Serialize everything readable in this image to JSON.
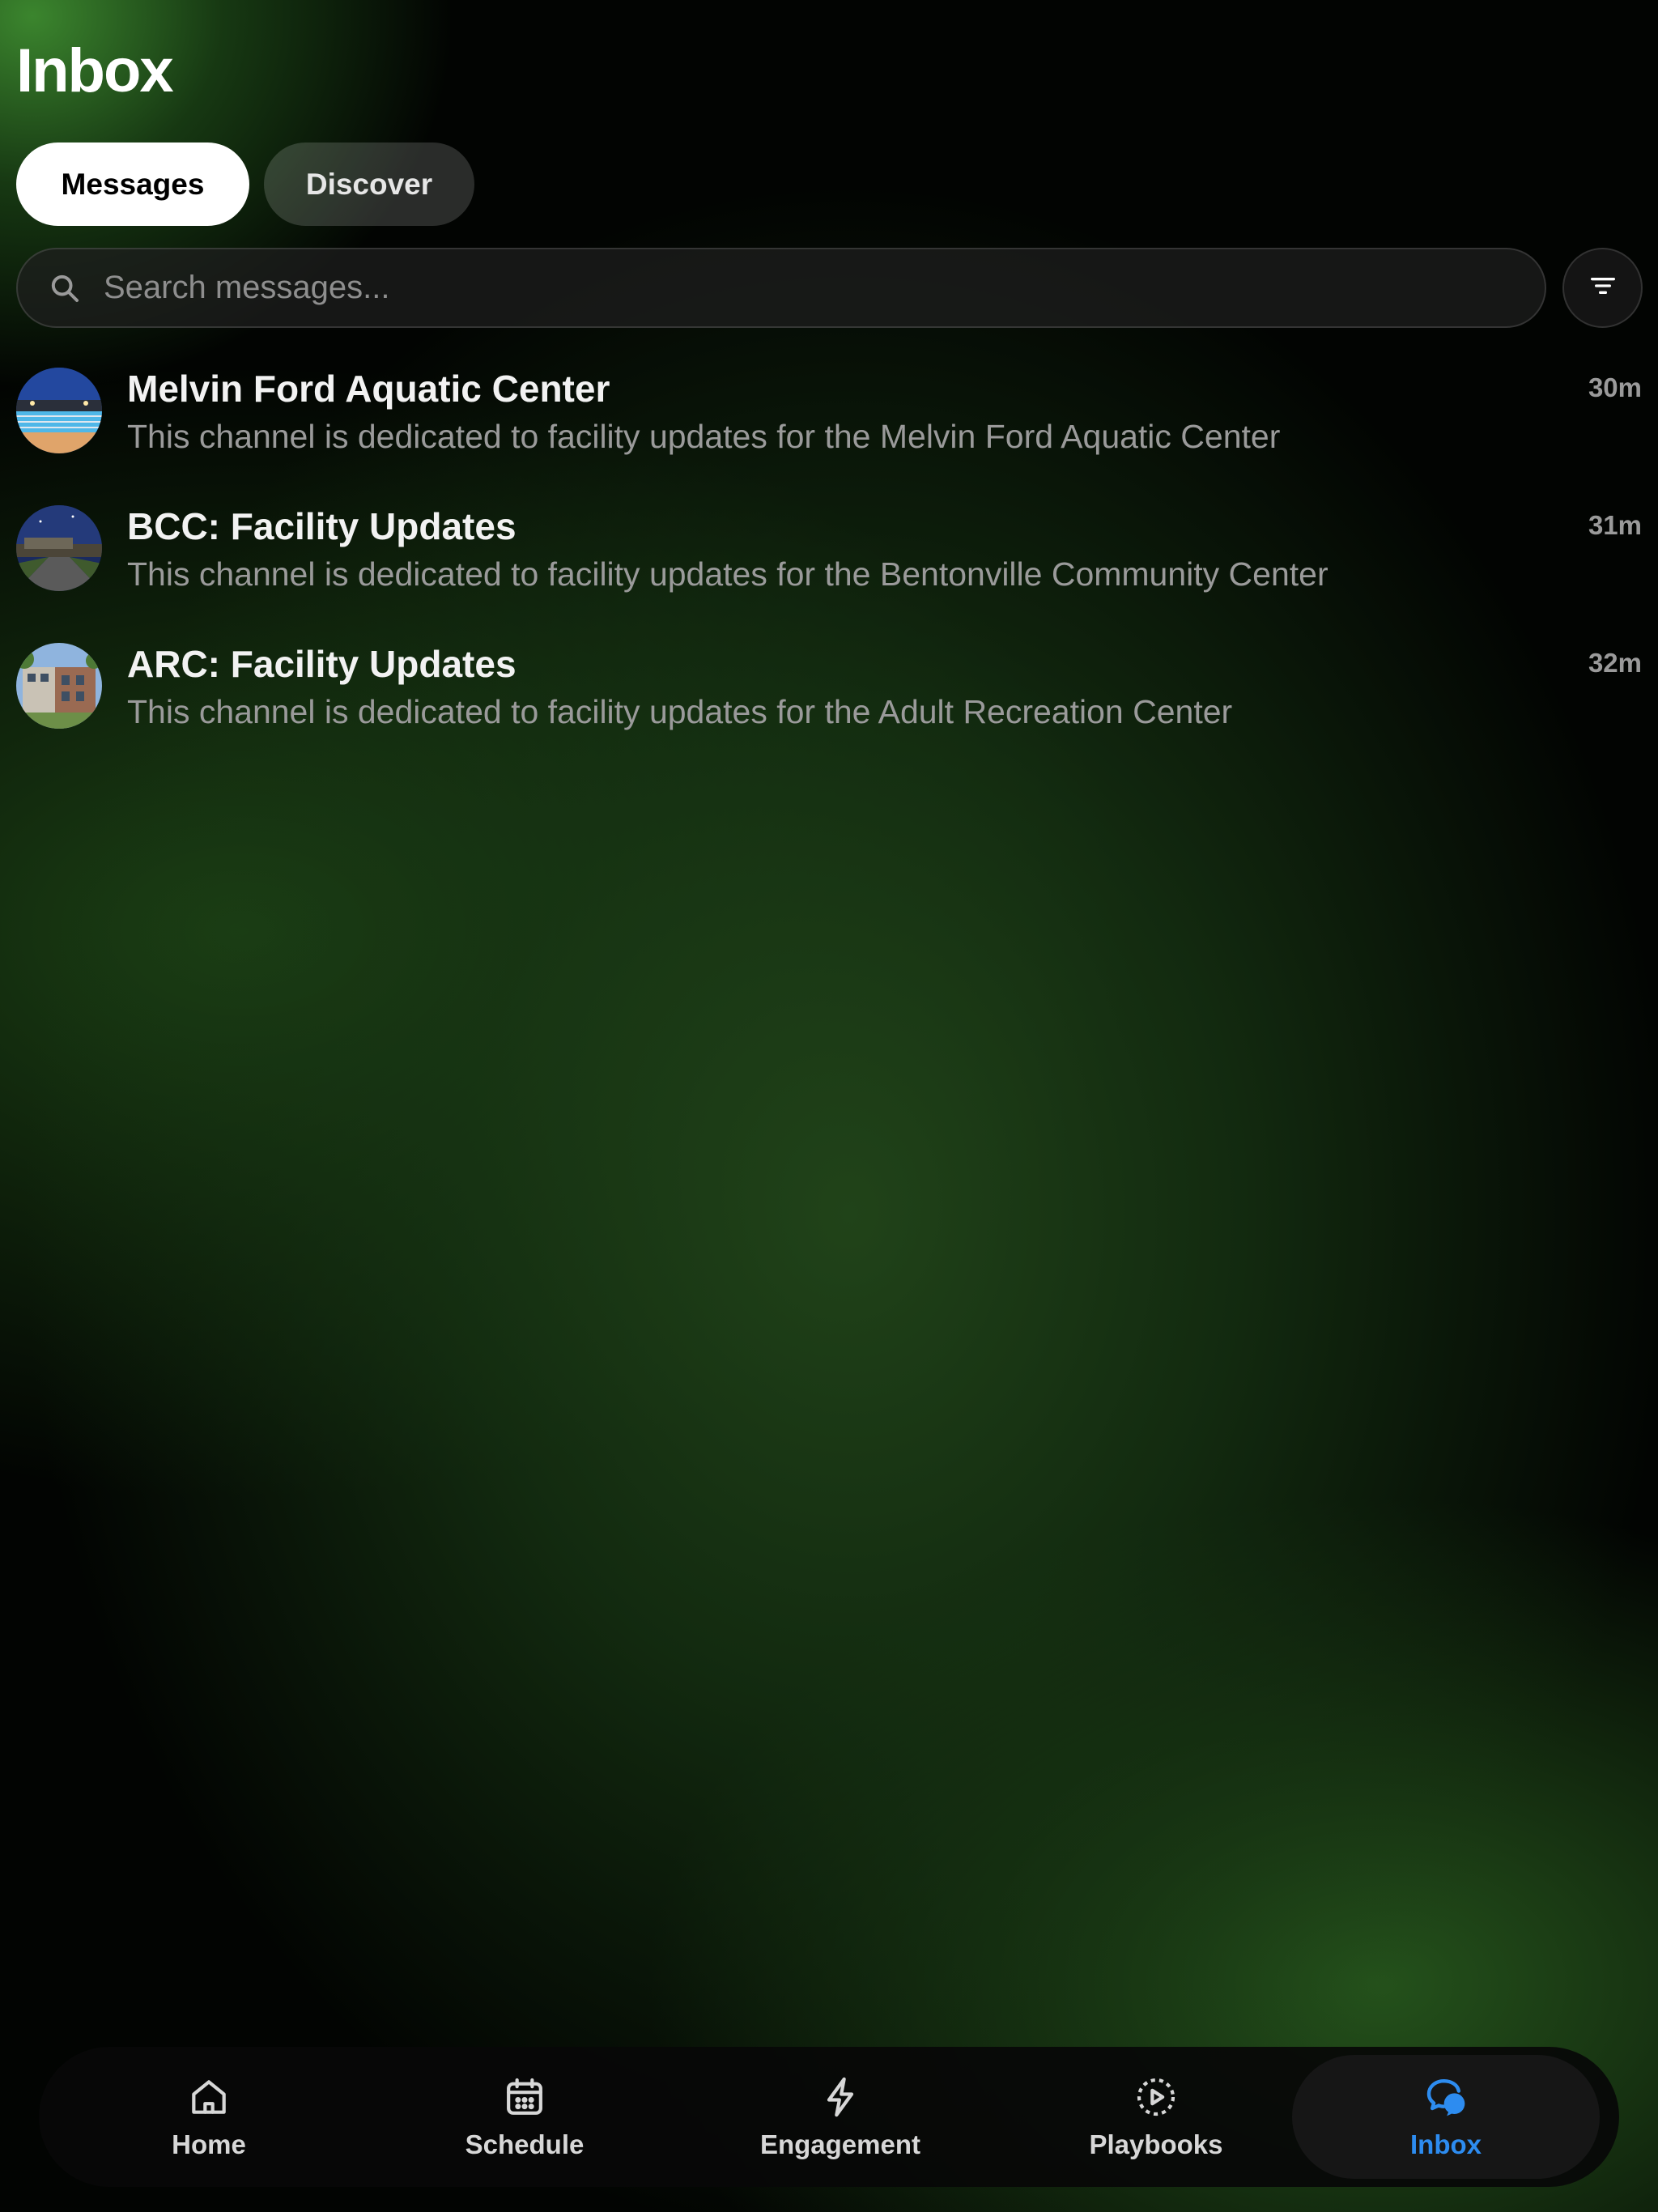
{
  "header": {
    "title": "Inbox"
  },
  "segments": {
    "messages": "Messages",
    "discover": "Discover",
    "active": "Messages"
  },
  "search": {
    "placeholder": "Search messages...",
    "value": ""
  },
  "channels": [
    {
      "name": "Melvin Ford Aquatic Center",
      "description": "This channel is dedicated to facility updates for the Melvin Ford Aquatic Center",
      "time": "30m",
      "avatar": "pool-photo"
    },
    {
      "name": "BCC: Facility Updates",
      "description": "This channel is dedicated to facility updates for the Bentonville Community Center",
      "time": "31m",
      "avatar": "community-center-photo"
    },
    {
      "name": "ARC: Facility Updates",
      "description": "This channel is dedicated to facility updates for the Adult Recreation Center",
      "time": "32m",
      "avatar": "recreation-center-photo"
    }
  ],
  "tabs": [
    {
      "label": "Home",
      "icon": "home-icon"
    },
    {
      "label": "Schedule",
      "icon": "calendar-icon"
    },
    {
      "label": "Engagement",
      "icon": "lightning-icon"
    },
    {
      "label": "Playbooks",
      "icon": "play-circle-icon"
    },
    {
      "label": "Inbox",
      "icon": "chat-bubbles-icon",
      "active": true
    }
  ],
  "colors": {
    "accent": "#2d8cf0",
    "background_green": "#2e6a24",
    "muted_text": "#9a9a9a"
  }
}
